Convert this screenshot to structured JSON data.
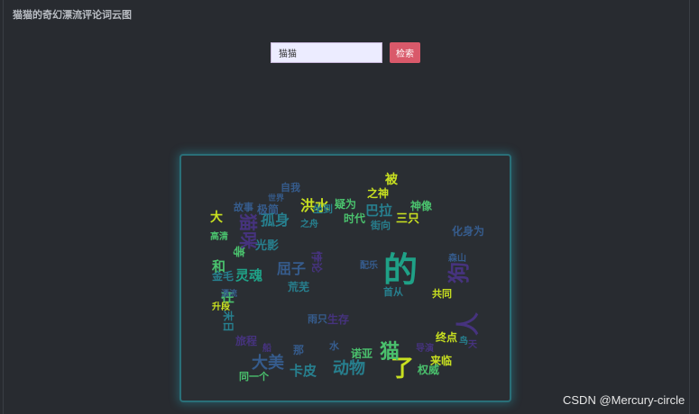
{
  "page": {
    "title": "猫猫的奇幻漂流评论词云图"
  },
  "search": {
    "value": "猫猫",
    "button_label": "检索"
  },
  "wordcloud": {
    "colors": {
      "purple": "#46337e",
      "blue": "#365c8d",
      "teal": "#277f8e",
      "green": "#1fa187",
      "lightgreen": "#4ac16d",
      "yellow": "#c8e020"
    },
    "words": [
      {
        "text": "的",
        "color": "green"
      },
      {
        "text": "了",
        "color": "yellow"
      },
      {
        "text": "猫",
        "color": "lightgreen"
      },
      {
        "text": "动物",
        "color": "teal"
      },
      {
        "text": "大美",
        "color": "blue"
      },
      {
        "text": "洪水",
        "color": "yellow"
      },
      {
        "text": "被",
        "color": "yellow"
      },
      {
        "text": "巴拉",
        "color": "teal"
      },
      {
        "text": "孤身",
        "color": "teal"
      },
      {
        "text": "三只",
        "color": "yellow"
      },
      {
        "text": "狗",
        "color": "purple"
      },
      {
        "text": "人",
        "color": "purple"
      },
      {
        "text": "来临",
        "color": "yellow"
      },
      {
        "text": "之神",
        "color": "yellow"
      },
      {
        "text": "神像",
        "color": "lightgreen"
      },
      {
        "text": "时代",
        "color": "lightgreen"
      },
      {
        "text": "街向",
        "color": "teal"
      },
      {
        "text": "首从",
        "color": "teal"
      },
      {
        "text": "权威",
        "color": "lightgreen"
      },
      {
        "text": "诺亚",
        "color": "lightgreen"
      },
      {
        "text": "坐到",
        "color": "teal"
      },
      {
        "text": "在",
        "color": "lightgreen"
      },
      {
        "text": "卡皮",
        "color": "teal"
      },
      {
        "text": "屈子",
        "color": "blue"
      },
      {
        "text": "荒芜",
        "color": "teal"
      },
      {
        "text": "之舟",
        "color": "teal"
      },
      {
        "text": "极简",
        "color": "blue"
      },
      {
        "text": "悖论",
        "color": "purple"
      },
      {
        "text": "自我",
        "color": "blue"
      },
      {
        "text": "疑为",
        "color": "lightgreen"
      },
      {
        "text": "化身为",
        "color": "blue"
      },
      {
        "text": "终点",
        "color": "yellow"
      },
      {
        "text": "共同",
        "color": "yellow"
      },
      {
        "text": "升段",
        "color": "yellow"
      },
      {
        "text": "金毛",
        "color": "teal"
      },
      {
        "text": "高清",
        "color": "lightgreen"
      },
      {
        "text": "同一个",
        "color": "lightgreen"
      },
      {
        "text": "大",
        "color": "yellow"
      },
      {
        "text": "和",
        "color": "lightgreen"
      },
      {
        "text": "那",
        "color": "blue"
      },
      {
        "text": "雨只",
        "color": "blue"
      },
      {
        "text": "生存",
        "color": "purple"
      },
      {
        "text": "故事",
        "color": "blue"
      },
      {
        "text": "世界",
        "color": "blue"
      },
      {
        "text": "导演",
        "color": "purple"
      },
      {
        "text": "森山",
        "color": "blue"
      },
      {
        "text": "配乐",
        "color": "blue"
      },
      {
        "text": "光影",
        "color": "teal"
      },
      {
        "text": "灵魂",
        "color": "green"
      },
      {
        "text": "等",
        "color": "lightgreen"
      },
      {
        "text": "猫咪",
        "color": "purple"
      },
      {
        "text": "末日",
        "color": "teal"
      },
      {
        "text": "旅程",
        "color": "purple"
      },
      {
        "text": "漂流",
        "color": "blue"
      },
      {
        "text": "鸟",
        "color": "teal"
      },
      {
        "text": "船",
        "color": "purple"
      },
      {
        "text": "水",
        "color": "blue"
      },
      {
        "text": "天",
        "color": "purple"
      }
    ]
  },
  "watermark": "CSDN @Mercury-circle"
}
